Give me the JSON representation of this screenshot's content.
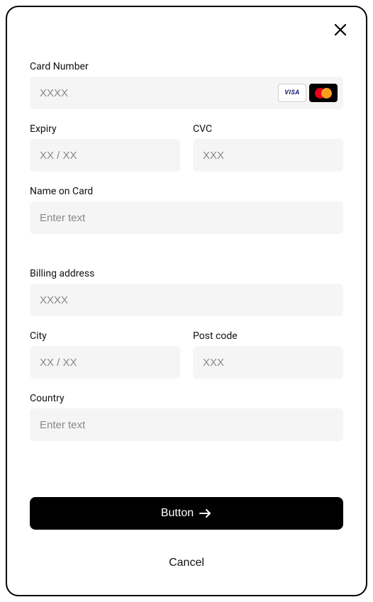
{
  "close_icon": "close",
  "fields": {
    "card_number": {
      "label": "Card Number",
      "placeholder": "XXXX"
    },
    "expiry": {
      "label": "Expiry",
      "placeholder": "XX / XX"
    },
    "cvc": {
      "label": "CVC",
      "placeholder": "XXX"
    },
    "name_on_card": {
      "label": "Name on Card",
      "placeholder": "Enter text"
    },
    "billing_address": {
      "label": "Billing address",
      "placeholder": "XXXX"
    },
    "city": {
      "label": "City",
      "placeholder": "XX / XX"
    },
    "post_code": {
      "label": "Post code",
      "placeholder": "XXX"
    },
    "country": {
      "label": "Country",
      "placeholder": "Enter text"
    }
  },
  "card_brands": {
    "visa": "VISA",
    "mastercard": "mastercard"
  },
  "buttons": {
    "primary": "Button",
    "cancel": "Cancel"
  }
}
